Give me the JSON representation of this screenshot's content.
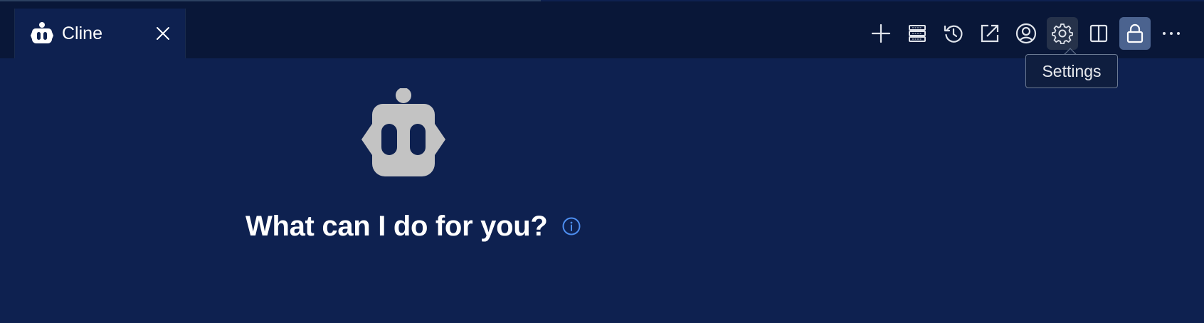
{
  "tab": {
    "title": "Cline",
    "logo_icon": "cline-robot-icon",
    "close_icon": "close-icon"
  },
  "toolbar": {
    "actions": [
      {
        "name": "new-task",
        "icon": "plus-icon"
      },
      {
        "name": "mcp-servers",
        "icon": "server-stack-icon"
      },
      {
        "name": "history",
        "icon": "history-icon"
      },
      {
        "name": "open-in-editor",
        "icon": "external-link-icon"
      },
      {
        "name": "account",
        "icon": "account-icon"
      },
      {
        "name": "settings",
        "icon": "gear-icon",
        "state": "hover"
      },
      {
        "name": "split-editor",
        "icon": "split-editor-icon"
      },
      {
        "name": "lock-group",
        "icon": "lock-icon",
        "state": "active"
      },
      {
        "name": "more-actions",
        "icon": "ellipsis-icon"
      }
    ]
  },
  "tooltip": {
    "text": "Settings"
  },
  "welcome": {
    "logo_icon": "cline-robot-icon",
    "headline": "What can I do for you?",
    "info_icon": "info-icon"
  },
  "colors": {
    "background": "#0e2150",
    "tabbar": "#091738",
    "text": "#ffffff",
    "logo": "#c3c3c3",
    "info_accent": "#4d8ef0",
    "active_button": "#4b638f"
  }
}
